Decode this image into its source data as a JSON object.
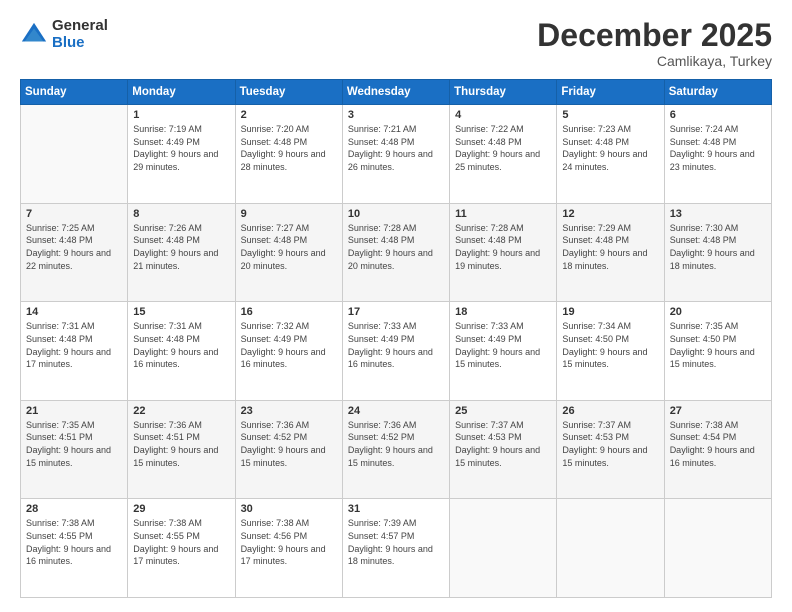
{
  "logo": {
    "general": "General",
    "blue": "Blue"
  },
  "header": {
    "month": "December 2025",
    "location": "Camlikaya, Turkey"
  },
  "days_of_week": [
    "Sunday",
    "Monday",
    "Tuesday",
    "Wednesday",
    "Thursday",
    "Friday",
    "Saturday"
  ],
  "weeks": [
    [
      {
        "day": "",
        "sunrise": "",
        "sunset": "",
        "daylight": ""
      },
      {
        "day": "1",
        "sunrise": "Sunrise: 7:19 AM",
        "sunset": "Sunset: 4:49 PM",
        "daylight": "Daylight: 9 hours and 29 minutes."
      },
      {
        "day": "2",
        "sunrise": "Sunrise: 7:20 AM",
        "sunset": "Sunset: 4:48 PM",
        "daylight": "Daylight: 9 hours and 28 minutes."
      },
      {
        "day": "3",
        "sunrise": "Sunrise: 7:21 AM",
        "sunset": "Sunset: 4:48 PM",
        "daylight": "Daylight: 9 hours and 26 minutes."
      },
      {
        "day": "4",
        "sunrise": "Sunrise: 7:22 AM",
        "sunset": "Sunset: 4:48 PM",
        "daylight": "Daylight: 9 hours and 25 minutes."
      },
      {
        "day": "5",
        "sunrise": "Sunrise: 7:23 AM",
        "sunset": "Sunset: 4:48 PM",
        "daylight": "Daylight: 9 hours and 24 minutes."
      },
      {
        "day": "6",
        "sunrise": "Sunrise: 7:24 AM",
        "sunset": "Sunset: 4:48 PM",
        "daylight": "Daylight: 9 hours and 23 minutes."
      }
    ],
    [
      {
        "day": "7",
        "sunrise": "Sunrise: 7:25 AM",
        "sunset": "Sunset: 4:48 PM",
        "daylight": "Daylight: 9 hours and 22 minutes."
      },
      {
        "day": "8",
        "sunrise": "Sunrise: 7:26 AM",
        "sunset": "Sunset: 4:48 PM",
        "daylight": "Daylight: 9 hours and 21 minutes."
      },
      {
        "day": "9",
        "sunrise": "Sunrise: 7:27 AM",
        "sunset": "Sunset: 4:48 PM",
        "daylight": "Daylight: 9 hours and 20 minutes."
      },
      {
        "day": "10",
        "sunrise": "Sunrise: 7:28 AM",
        "sunset": "Sunset: 4:48 PM",
        "daylight": "Daylight: 9 hours and 20 minutes."
      },
      {
        "day": "11",
        "sunrise": "Sunrise: 7:28 AM",
        "sunset": "Sunset: 4:48 PM",
        "daylight": "Daylight: 9 hours and 19 minutes."
      },
      {
        "day": "12",
        "sunrise": "Sunrise: 7:29 AM",
        "sunset": "Sunset: 4:48 PM",
        "daylight": "Daylight: 9 hours and 18 minutes."
      },
      {
        "day": "13",
        "sunrise": "Sunrise: 7:30 AM",
        "sunset": "Sunset: 4:48 PM",
        "daylight": "Daylight: 9 hours and 18 minutes."
      }
    ],
    [
      {
        "day": "14",
        "sunrise": "Sunrise: 7:31 AM",
        "sunset": "Sunset: 4:48 PM",
        "daylight": "Daylight: 9 hours and 17 minutes."
      },
      {
        "day": "15",
        "sunrise": "Sunrise: 7:31 AM",
        "sunset": "Sunset: 4:48 PM",
        "daylight": "Daylight: 9 hours and 16 minutes."
      },
      {
        "day": "16",
        "sunrise": "Sunrise: 7:32 AM",
        "sunset": "Sunset: 4:49 PM",
        "daylight": "Daylight: 9 hours and 16 minutes."
      },
      {
        "day": "17",
        "sunrise": "Sunrise: 7:33 AM",
        "sunset": "Sunset: 4:49 PM",
        "daylight": "Daylight: 9 hours and 16 minutes."
      },
      {
        "day": "18",
        "sunrise": "Sunrise: 7:33 AM",
        "sunset": "Sunset: 4:49 PM",
        "daylight": "Daylight: 9 hours and 15 minutes."
      },
      {
        "day": "19",
        "sunrise": "Sunrise: 7:34 AM",
        "sunset": "Sunset: 4:50 PM",
        "daylight": "Daylight: 9 hours and 15 minutes."
      },
      {
        "day": "20",
        "sunrise": "Sunrise: 7:35 AM",
        "sunset": "Sunset: 4:50 PM",
        "daylight": "Daylight: 9 hours and 15 minutes."
      }
    ],
    [
      {
        "day": "21",
        "sunrise": "Sunrise: 7:35 AM",
        "sunset": "Sunset: 4:51 PM",
        "daylight": "Daylight: 9 hours and 15 minutes."
      },
      {
        "day": "22",
        "sunrise": "Sunrise: 7:36 AM",
        "sunset": "Sunset: 4:51 PM",
        "daylight": "Daylight: 9 hours and 15 minutes."
      },
      {
        "day": "23",
        "sunrise": "Sunrise: 7:36 AM",
        "sunset": "Sunset: 4:52 PM",
        "daylight": "Daylight: 9 hours and 15 minutes."
      },
      {
        "day": "24",
        "sunrise": "Sunrise: 7:36 AM",
        "sunset": "Sunset: 4:52 PM",
        "daylight": "Daylight: 9 hours and 15 minutes."
      },
      {
        "day": "25",
        "sunrise": "Sunrise: 7:37 AM",
        "sunset": "Sunset: 4:53 PM",
        "daylight": "Daylight: 9 hours and 15 minutes."
      },
      {
        "day": "26",
        "sunrise": "Sunrise: 7:37 AM",
        "sunset": "Sunset: 4:53 PM",
        "daylight": "Daylight: 9 hours and 15 minutes."
      },
      {
        "day": "27",
        "sunrise": "Sunrise: 7:38 AM",
        "sunset": "Sunset: 4:54 PM",
        "daylight": "Daylight: 9 hours and 16 minutes."
      }
    ],
    [
      {
        "day": "28",
        "sunrise": "Sunrise: 7:38 AM",
        "sunset": "Sunset: 4:55 PM",
        "daylight": "Daylight: 9 hours and 16 minutes."
      },
      {
        "day": "29",
        "sunrise": "Sunrise: 7:38 AM",
        "sunset": "Sunset: 4:55 PM",
        "daylight": "Daylight: 9 hours and 17 minutes."
      },
      {
        "day": "30",
        "sunrise": "Sunrise: 7:38 AM",
        "sunset": "Sunset: 4:56 PM",
        "daylight": "Daylight: 9 hours and 17 minutes."
      },
      {
        "day": "31",
        "sunrise": "Sunrise: 7:39 AM",
        "sunset": "Sunset: 4:57 PM",
        "daylight": "Daylight: 9 hours and 18 minutes."
      },
      {
        "day": "",
        "sunrise": "",
        "sunset": "",
        "daylight": ""
      },
      {
        "day": "",
        "sunrise": "",
        "sunset": "",
        "daylight": ""
      },
      {
        "day": "",
        "sunrise": "",
        "sunset": "",
        "daylight": ""
      }
    ]
  ]
}
